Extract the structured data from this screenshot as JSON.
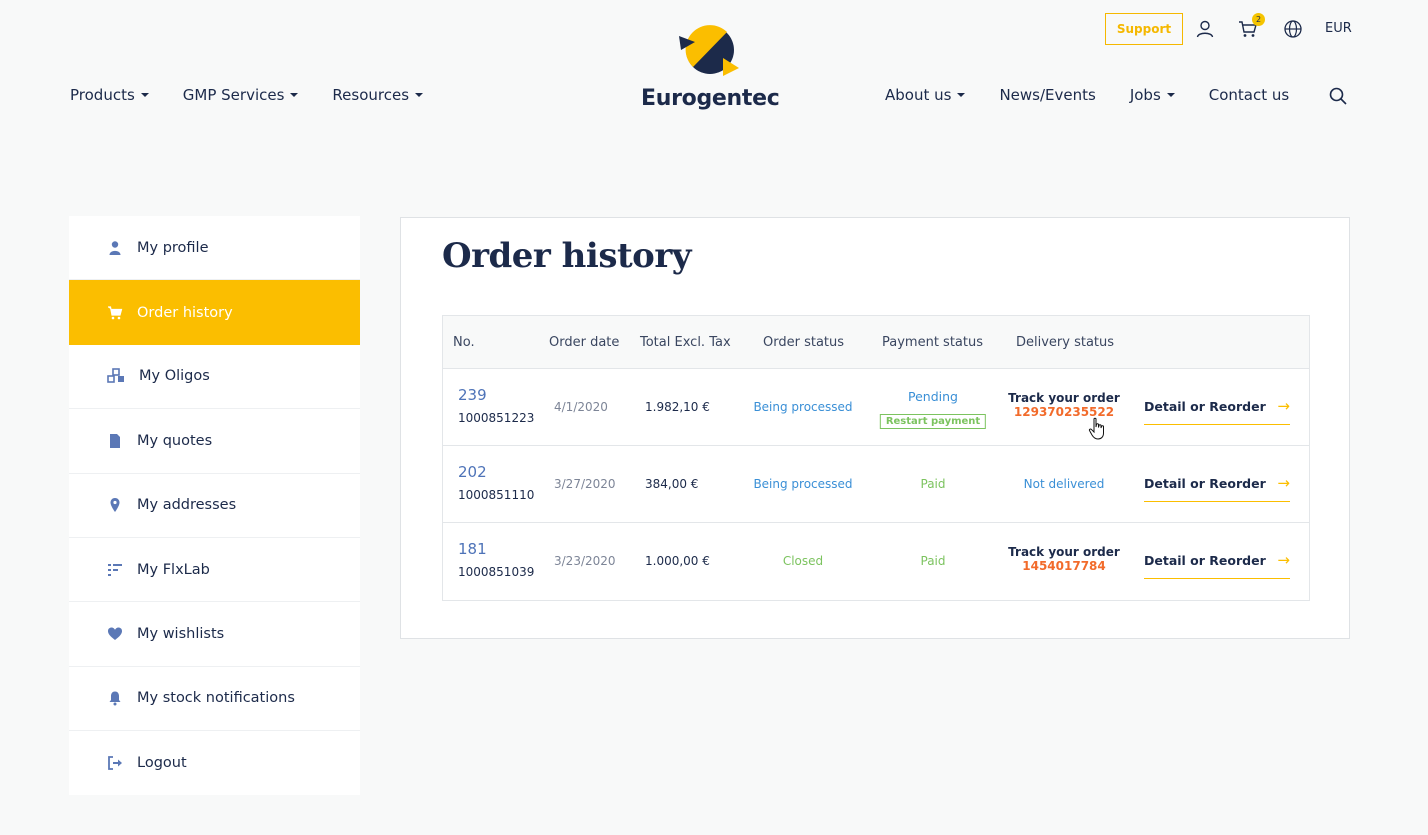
{
  "header": {
    "support_label": "Support",
    "cart_count": "2",
    "currency": "EUR",
    "logo_text": "Eurogentec",
    "nav_left": [
      "Products",
      "GMP Services",
      "Resources"
    ],
    "nav_right": [
      "About us",
      "News/Events",
      "Jobs",
      "Contact us"
    ]
  },
  "sidebar": {
    "items": [
      {
        "label": "My profile",
        "icon": "user-icon"
      },
      {
        "label": "Order history",
        "icon": "cart-icon"
      },
      {
        "label": "My Oligos",
        "icon": "oligos-icon"
      },
      {
        "label": "My quotes",
        "icon": "document-icon"
      },
      {
        "label": "My addresses",
        "icon": "location-pin-icon"
      },
      {
        "label": "My FlxLab",
        "icon": "flxlab-icon"
      },
      {
        "label": "My wishlists",
        "icon": "heart-icon"
      },
      {
        "label": "My stock notifications",
        "icon": "bell-icon"
      },
      {
        "label": "Logout",
        "icon": "logout-icon"
      }
    ]
  },
  "main": {
    "title": "Order history",
    "columns": [
      "No.",
      "Order date",
      "Total Excl. Tax",
      "Order status",
      "Payment status",
      "Delivery status"
    ],
    "rows": [
      {
        "no": "239",
        "ref": "1000851223",
        "date": "4/1/2020",
        "total": "1.982,10 €",
        "order_status": "Being processed",
        "payment_status": "Pending",
        "payment_action": "Restart payment",
        "delivery_label": "Track your order",
        "delivery_value": "129370235522",
        "action": "Detail or Reorder",
        "arrow": "→"
      },
      {
        "no": "202",
        "ref": "1000851110",
        "date": "3/27/2020",
        "total": "384,00 €",
        "order_status": "Being processed",
        "payment_status": "Paid",
        "delivery_status": "Not delivered",
        "action": "Detail or Reorder",
        "arrow": "→"
      },
      {
        "no": "181",
        "ref": "1000851039",
        "date": "3/23/2020",
        "total": "1.000,00 €",
        "order_status": "Closed",
        "payment_status": "Paid",
        "delivery_label": "Track your order",
        "delivery_value": "1454017784",
        "action": "Detail or Reorder",
        "arrow": "→"
      }
    ]
  },
  "colors": {
    "accent": "#fbbe00",
    "navy": "#1c2a4a",
    "blue_status": "#3a8fd6",
    "green_status": "#7cc35f",
    "tracking": "#f26b2b"
  }
}
